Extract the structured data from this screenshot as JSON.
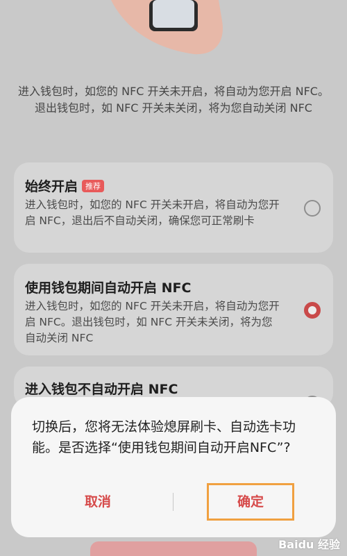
{
  "intro_text": "进入钱包时，如您的 NFC 开关未开启，将自动为您开启 NFC。退出钱包时，如 NFC 开关未关闭，将为您自动关闭 NFC",
  "options": [
    {
      "title": "始终开启",
      "badge": "推荐",
      "desc": "进入钱包时，如您的 NFC 开关未开启，将自动为您开启 NFC，退出后不自动关闭，确保您可正常刷卡",
      "selected": false
    },
    {
      "title": "使用钱包期间自动开启 NFC",
      "desc": "进入钱包时，如您的 NFC 开关未开启，将自动为您开启 NFC。退出钱包时，如 NFC 开关未关闭，将为您自动关闭 NFC",
      "selected": true
    },
    {
      "title": "进入钱包不自动开启 NFC",
      "selected": false
    }
  ],
  "dialog": {
    "message": "切换后，您将无法体验熄屏刷卡、自动选卡功能。是否选择“使用钱包期间自动开启NFC”?",
    "cancel": "取消",
    "confirm": "确定"
  },
  "colors": {
    "accent": "#d64a4a",
    "highlight": "#f0a040"
  },
  "watermark": "Baidu 经验"
}
